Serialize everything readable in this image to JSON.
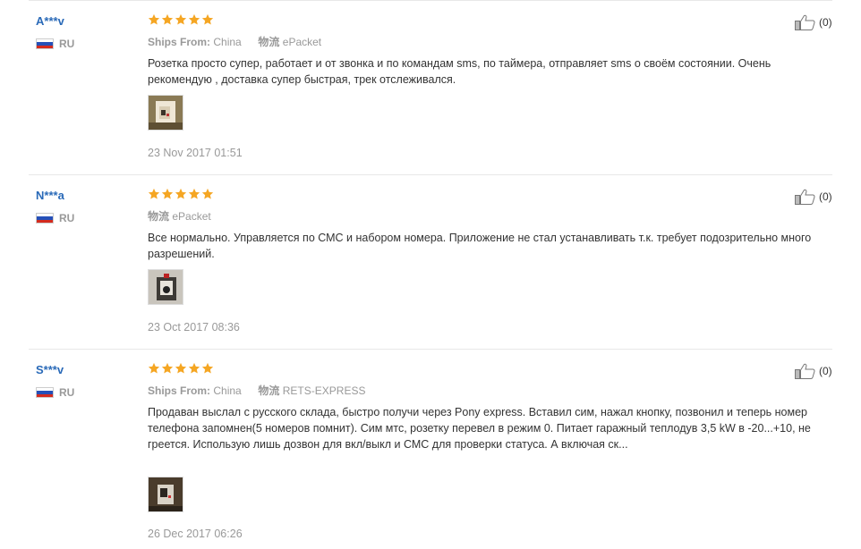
{
  "reviews": [
    {
      "user": "A***v",
      "country": "RU",
      "stars": 5,
      "ships_from_label": "Ships From:",
      "ships_from_value": "China",
      "logistics_label": "物流",
      "logistics_value": "ePacket",
      "text": "Розетка просто супер, работает и от звонка и по командам sms, по таймера, отправляет sms о своём состоянии. Очень рекомендую , доставка супер быстрая, трек отслеживался.",
      "date": "23 Nov 2017 01:51",
      "likes": "(0)"
    },
    {
      "user": "N***a",
      "country": "RU",
      "stars": 5,
      "logistics_label": "物流",
      "logistics_value": "ePacket",
      "text": "Все нормально. Управляется по СМС и набором номера. Приложение не стал устанавливать т.к. требует подозрительно много разрешений.",
      "date": "23 Oct 2017 08:36",
      "likes": "(0)"
    },
    {
      "user": "S***v",
      "country": "RU",
      "stars": 5,
      "ships_from_label": "Ships From:",
      "ships_from_value": "China",
      "logistics_label": "物流",
      "logistics_value": "RETS-EXPRESS",
      "text": "Продаван выслал с русского склада, быстро получи через Pony express. Вставил сим, нажал кнопку, позвонил и теперь номер телефона запомнен(5 номеров помнит). Сим мтс, розетку перевел в режим 0. Питает гаражный теплодув 3,5 kW в -20...+10, не греется. Использую лишь дозвон для вкл/выкл и СМС для проверки статуса. А включая ск...",
      "date": "26 Dec 2017 06:26",
      "likes": "(0)"
    }
  ],
  "colors": {
    "star": "#f5a623",
    "user": "#2a6ab8",
    "muted": "#999999"
  },
  "icons": {
    "rating": "star-icon",
    "like": "thumbs-up-icon",
    "flag": "russia-flag-icon"
  }
}
